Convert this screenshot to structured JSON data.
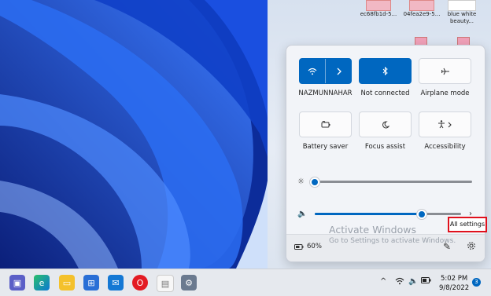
{
  "desktop_icons": [
    {
      "label": "ec68fb1d-5..."
    },
    {
      "label": "04fea2e9-5..."
    },
    {
      "label": "blue white"
    },
    {
      "label": "beauty..."
    }
  ],
  "quick_settings": {
    "tiles_row1": [
      {
        "label": "NAZMUNNAHAR",
        "icon": "wifi-icon",
        "state": "on"
      },
      {
        "label": "Not connected",
        "icon": "bluetooth-icon",
        "state": "on"
      },
      {
        "label": "Airplane mode",
        "icon": "airplane-icon",
        "state": "off"
      }
    ],
    "tiles_row2": [
      {
        "label": "Battery saver",
        "icon": "battery-saver-icon",
        "state": "off"
      },
      {
        "label": "Focus assist",
        "icon": "moon-icon",
        "state": "off"
      },
      {
        "label": "Accessibility",
        "icon": "accessibility-icon",
        "state": "off"
      }
    ],
    "brightness": {
      "level": 0.0
    },
    "volume": {
      "level": 0.73
    },
    "battery_text": "60%",
    "all_settings_tooltip": "All settings"
  },
  "watermark": {
    "line1": "Activate Windows",
    "line2": "Go to Settings to activate Windows."
  },
  "taskbar": {
    "time": "5:02 PM",
    "date": "9/8/2022",
    "notification_count": "3"
  },
  "colors": {
    "accent": "#0067c0",
    "tooltip_border": "#e0101c"
  }
}
